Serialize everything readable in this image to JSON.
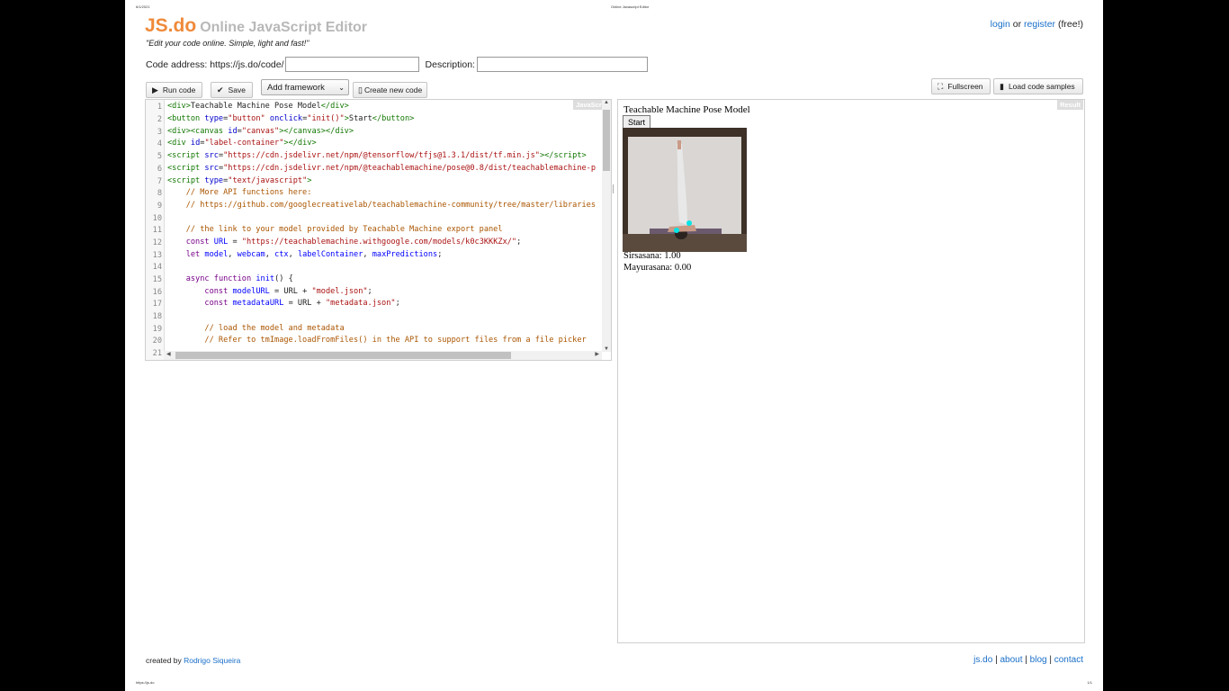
{
  "print_header": {
    "date": "6/1/2021",
    "title": "Online Javascript Editor"
  },
  "print_footer": {
    "url": "https://js.do",
    "page": "1/1"
  },
  "logo": {
    "brand": "JS.do",
    "subtitle": "Online JavaScript Editor"
  },
  "tagline": "\"Edit your code online. Simple, light and fast!\"",
  "auth": {
    "login": "login",
    "or": "or",
    "register": "register",
    "free": "(free!)"
  },
  "code_address": {
    "label": "Code address: https://js.do/code/",
    "value": "",
    "description_label": "Description:",
    "description_value": ""
  },
  "toolbar": {
    "run": "Run code",
    "save": "Save",
    "framework": "Add framework",
    "create_new": "Create new code",
    "fullscreen": "Fullscreen",
    "load_samples": "Load code samples"
  },
  "editor": {
    "mode_label": "JavaScript",
    "line_numbers": [
      "1",
      "2",
      "3",
      "4",
      "5",
      "6",
      "7",
      "8",
      "9",
      "10",
      "11",
      "12",
      "13",
      "14",
      "15",
      "16",
      "17",
      "18",
      "19",
      "20",
      "21"
    ]
  },
  "result": {
    "label": "Result",
    "title": "Teachable Machine Pose Model",
    "start_button": "Start",
    "predictions": [
      "Sirsasana: 1.00",
      "Mayurasana: 0.00"
    ]
  },
  "footer": {
    "created_by": "created by",
    "author": "Rodrigo Siqueira",
    "links": [
      "js.do",
      "about",
      "blog",
      "contact"
    ],
    "sep": "|"
  },
  "colors": {
    "brand": "#ef8a3a",
    "link": "#1a6fc9",
    "keypoint": "#00e5e5"
  }
}
